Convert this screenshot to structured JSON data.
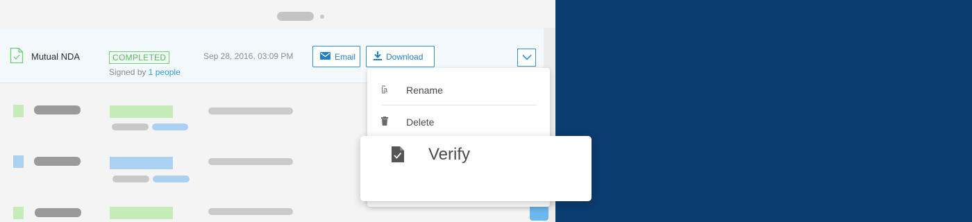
{
  "pager": {
    "page_count": 2,
    "active_page": 1
  },
  "document_row": {
    "name": "Mutual NDA",
    "icon": "document-check-icon",
    "status": "COMPLETED",
    "signed_by_prefix": "Signed by",
    "signed_by_link": "1 people",
    "date": "Sep 28, 2016, 03:09 PM",
    "email_label": "Email",
    "download_label": "Download",
    "expand_icon": "chevron-down-icon"
  },
  "menu": {
    "items": [
      {
        "label": "Rename",
        "icon": "rename-icon"
      },
      {
        "label": "Delete",
        "icon": "trash-icon"
      },
      {
        "label": "Verify",
        "icon": "document-check-icon"
      }
    ]
  },
  "colors": {
    "accent": "#2f8fd6",
    "completed": "#56bb56",
    "right_background": "#0b3c70",
    "placeholder_gray": "#9a9a9a",
    "placeholder_green": "#c5ebb9",
    "placeholder_blue": "#aad1f2"
  }
}
